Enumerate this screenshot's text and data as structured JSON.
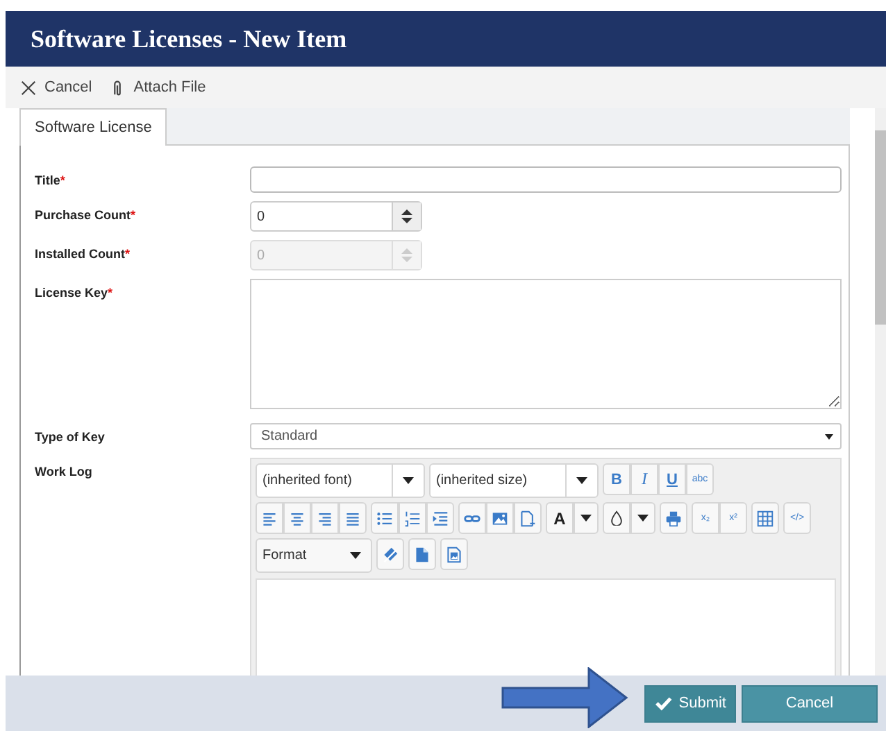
{
  "window": {
    "title": "Software Licenses - New Item"
  },
  "toolbar": [
    {
      "label": "Cancel"
    },
    {
      "label": "Attach File"
    }
  ],
  "tabs": [
    {
      "label": "Software License",
      "selected": true
    }
  ],
  "fields": [
    {
      "kind": "text",
      "label": "Title",
      "required_mark": "*"
    },
    {
      "kind": "number",
      "label": "Purchase Count",
      "required_mark": "*",
      "value": "0",
      "disabled": false
    },
    {
      "kind": "number",
      "label": "Installed Count",
      "required_mark": "*",
      "value": "0",
      "disabled": true
    },
    {
      "kind": "textarea",
      "label": "License Key",
      "required_mark": "*"
    },
    {
      "kind": "select",
      "label": "Type of Key",
      "value": "Standard"
    },
    {
      "kind": "richtext",
      "label": "Work Log"
    }
  ],
  "editor": {
    "rows": [
      [
        [
          {
            "kind": "dropdown",
            "value": "(inherited font)"
          }
        ],
        [
          {
            "kind": "dropdown",
            "value": "(inherited size)"
          }
        ],
        [
          {
            "kind": "text",
            "label": "B"
          },
          {
            "kind": "text",
            "label": "I"
          },
          {
            "kind": "text",
            "label": "U"
          },
          {
            "kind": "text",
            "label": "abc"
          }
        ]
      ],
      [
        [
          {
            "kind": "icon"
          },
          {
            "kind": "icon"
          },
          {
            "kind": "icon"
          },
          {
            "kind": "icon"
          }
        ],
        [
          {
            "kind": "icon"
          },
          {
            "kind": "icon"
          },
          {
            "kind": "icon"
          }
        ],
        [
          {
            "kind": "icon"
          },
          {
            "kind": "icon"
          },
          {
            "kind": "icon"
          }
        ],
        [
          {
            "kind": "text",
            "label": "A"
          },
          {
            "kind": "caret"
          }
        ],
        [
          {
            "kind": "icon"
          },
          {
            "kind": "caret"
          }
        ],
        [
          {
            "kind": "icon"
          }
        ],
        [
          {
            "kind": "text",
            "label": "x₂"
          },
          {
            "kind": "text",
            "label": "x²"
          }
        ],
        [
          {
            "kind": "icon"
          }
        ],
        [
          {
            "kind": "text",
            "label": "</>"
          }
        ]
      ],
      [
        [
          {
            "kind": "dropdown",
            "value": "Format"
          }
        ],
        [
          {
            "kind": "icon"
          }
        ],
        [
          {
            "kind": "icon"
          }
        ],
        [
          {
            "kind": "icon"
          }
        ]
      ]
    ]
  },
  "footer": {
    "buttons": [
      {
        "label": "Submit"
      },
      {
        "label": "Cancel"
      }
    ]
  }
}
